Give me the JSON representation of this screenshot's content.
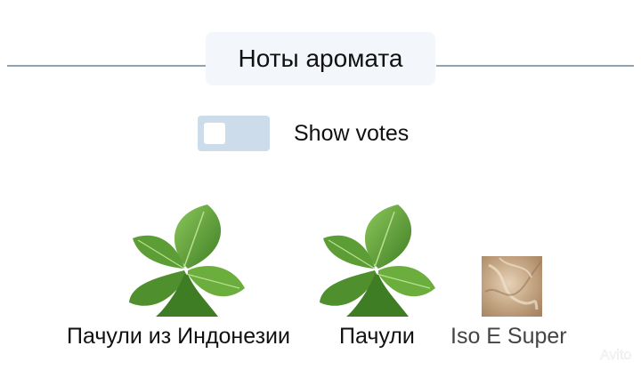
{
  "section": {
    "title": "Ноты аромата"
  },
  "votes_toggle": {
    "label": "Show votes",
    "state": "off",
    "track_color": "#ccdceb"
  },
  "notes": [
    {
      "name": "Пачули из Индонезии",
      "icon": "patchouli-leaf-icon"
    },
    {
      "name": "Пачули",
      "icon": "patchouli-leaf-icon"
    },
    {
      "name": "Iso E Super",
      "icon": "iso-e-super-swatch-icon"
    }
  ],
  "watermark": {
    "text": "Avito"
  },
  "colors": {
    "divider": "#8fa3b3",
    "title_bg": "#f3f6fa",
    "leaf_green": "#5c9e35",
    "iso_swatch": "#c8aa88"
  }
}
